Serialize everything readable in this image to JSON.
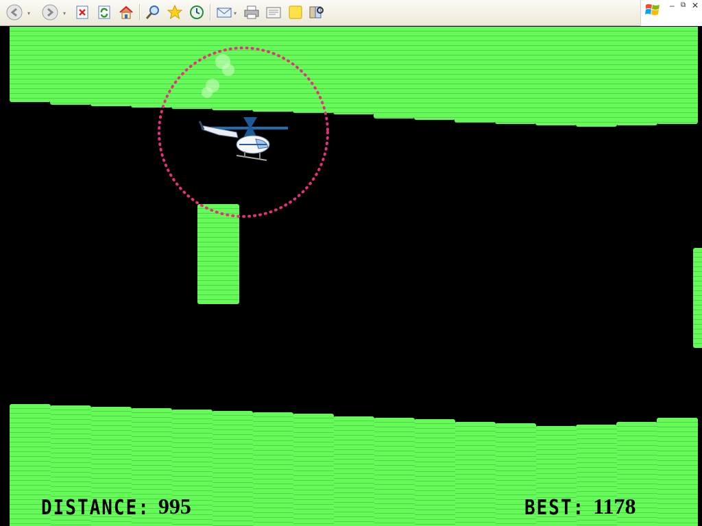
{
  "toolbar": {
    "buttons": [
      {
        "name": "back-button",
        "icon": "back-arrow-icon"
      },
      {
        "name": "forward-button",
        "icon": "forward-arrow-icon"
      },
      {
        "name": "stop-button",
        "icon": "stop-icon"
      },
      {
        "name": "refresh-button",
        "icon": "refresh-icon"
      },
      {
        "name": "home-button",
        "icon": "home-icon"
      },
      {
        "name": "search-button",
        "icon": "search-icon"
      },
      {
        "name": "favorites-button",
        "icon": "star-icon"
      },
      {
        "name": "history-button",
        "icon": "history-icon"
      },
      {
        "name": "mail-button",
        "icon": "mail-icon"
      },
      {
        "name": "print-button",
        "icon": "printer-icon"
      },
      {
        "name": "edit-button",
        "icon": "edit-icon"
      },
      {
        "name": "discuss-button",
        "icon": "note-icon"
      },
      {
        "name": "research-button",
        "icon": "research-icon"
      }
    ]
  },
  "game": {
    "hud": {
      "distance_label": "DISTANCE:",
      "distance_value": "995",
      "best_label": "BEST:",
      "best_value": "1178"
    },
    "colors": {
      "cave": "#66f95a",
      "background": "#000000",
      "highlight_circle": "#e8307a"
    }
  }
}
